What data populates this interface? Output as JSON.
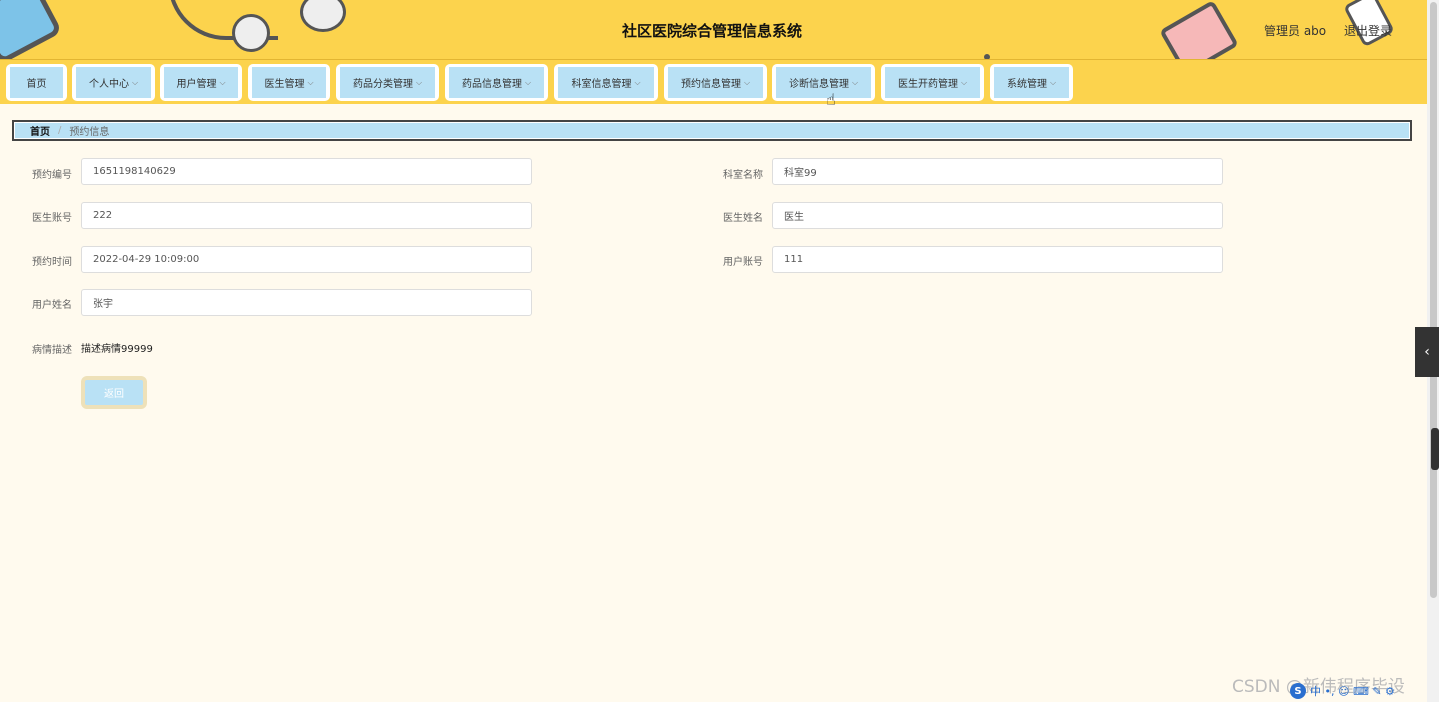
{
  "header": {
    "title": "社区医院综合管理信息系统",
    "user": "管理员 abo",
    "logout": "退出登录"
  },
  "nav": [
    {
      "label": "首页",
      "has_dropdown": false
    },
    {
      "label": "个人中心",
      "has_dropdown": true
    },
    {
      "label": "用户管理",
      "has_dropdown": true
    },
    {
      "label": "医生管理",
      "has_dropdown": true
    },
    {
      "label": "药品分类管理",
      "has_dropdown": true
    },
    {
      "label": "药品信息管理",
      "has_dropdown": true
    },
    {
      "label": "科室信息管理",
      "has_dropdown": true
    },
    {
      "label": "预约信息管理",
      "has_dropdown": true
    },
    {
      "label": "诊断信息管理",
      "has_dropdown": true
    },
    {
      "label": "医生开药管理",
      "has_dropdown": true
    },
    {
      "label": "系统管理",
      "has_dropdown": true
    }
  ],
  "breadcrumb": {
    "home": "首页",
    "separator": "/",
    "current": "预约信息"
  },
  "form": {
    "appointment_no": {
      "label": "预约编号",
      "value": "1651198140629"
    },
    "department_name": {
      "label": "科室名称",
      "value": "科室99"
    },
    "doctor_account": {
      "label": "医生账号",
      "value": "222"
    },
    "doctor_name": {
      "label": "医生姓名",
      "value": "医生"
    },
    "appointment_time": {
      "label": "预约时间",
      "value": "2022-04-29 10:09:00"
    },
    "user_account": {
      "label": "用户账号",
      "value": "111"
    },
    "user_name": {
      "label": "用户姓名",
      "value": "张宇"
    },
    "condition": {
      "label": "病情描述",
      "value": "描述病情99999"
    }
  },
  "back_button": "返回",
  "watermark": "CSDN @新伟程序毕设",
  "ime": {
    "logo": "S",
    "glyphs": "中 •, ☺ ⌨ ✎ ⚙"
  },
  "colors": {
    "header_bg": "#fcd34d",
    "nav_item_bg": "#b9e1f5",
    "page_bg": "#fffaee"
  },
  "icons": {
    "side_toggle": "chevron-left-icon",
    "cursor": "hand-pointer-icon"
  }
}
